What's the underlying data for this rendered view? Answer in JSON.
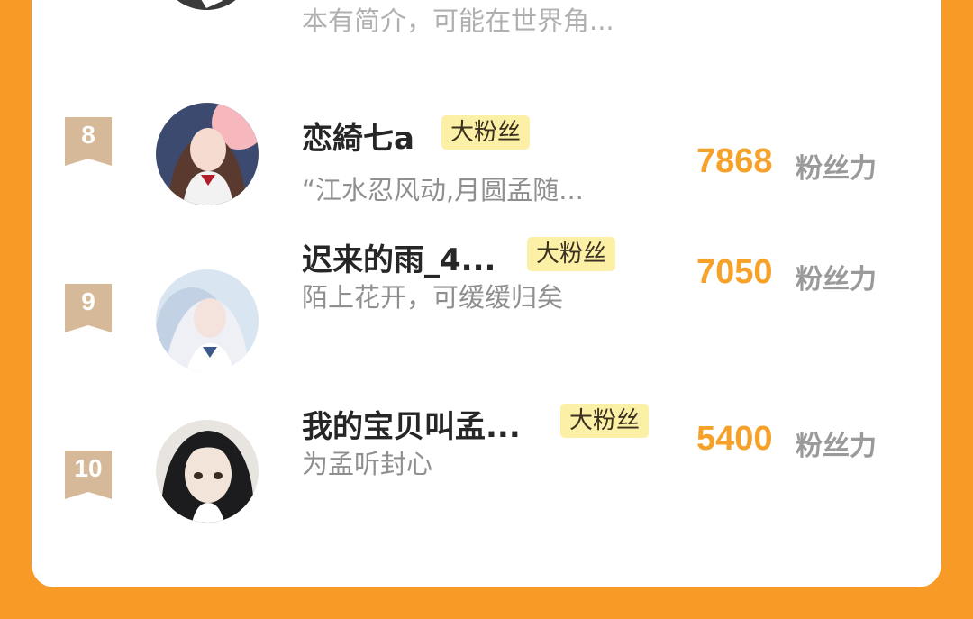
{
  "colors": {
    "page_bg": "#f89a26",
    "card_bg": "#ffffff",
    "score": "#f5a12a",
    "badge_bg": "#fcefa6",
    "rank_ribbon": "#d6b999"
  },
  "prev_row": {
    "subtitle": "本有简介，可能在世界角..."
  },
  "unit_label": "粉丝力",
  "rows": [
    {
      "rank": "8",
      "name": "恋綺七a",
      "badge": "大粉丝",
      "subtitle": "“江水忍风动,月圆孟随...",
      "score": "7868"
    },
    {
      "rank": "9",
      "name": "迟来的雨_4...",
      "badge": "大粉丝",
      "subtitle": "陌上花开，可缓缓归矣",
      "score": "7050"
    },
    {
      "rank": "10",
      "name": "我的宝贝叫孟...",
      "badge": "大粉丝",
      "subtitle": "为孟听封心",
      "score": "5400"
    }
  ]
}
